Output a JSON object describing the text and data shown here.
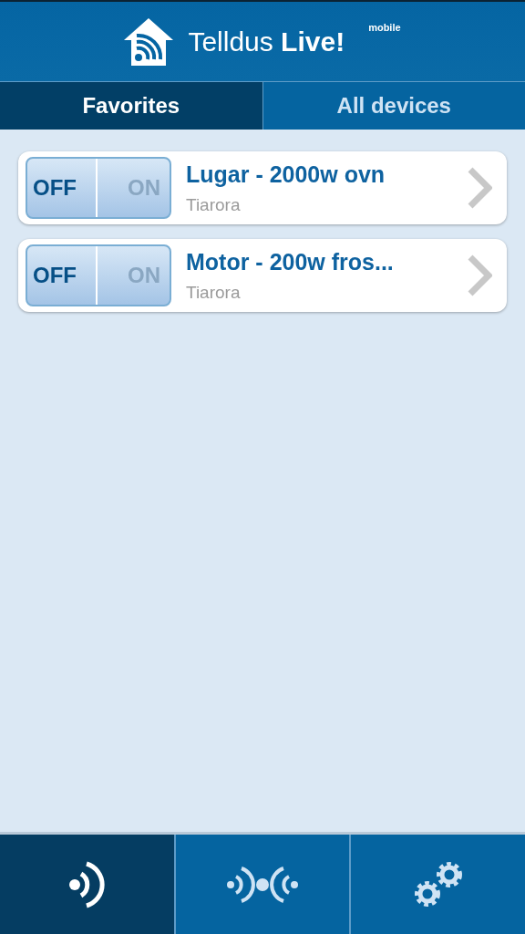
{
  "header": {
    "title": "Telldus **Live!**",
    "badge": "mobile"
  },
  "tabs": [
    {
      "label": "Favorites",
      "selected": true
    },
    {
      "label": "All devices",
      "selected": false
    }
  ],
  "devices": [
    {
      "name": "Lugar - 2000w ovn",
      "location": "Tiarora",
      "off_label": "OFF",
      "on_label": "ON",
      "on": false
    },
    {
      "name": "Motor - 200w fros...",
      "location": "Tiarora",
      "off_label": "OFF",
      "on_label": "ON",
      "on": false
    }
  ],
  "bottom_nav": [
    {
      "kind": "signal",
      "selected": true
    },
    {
      "kind": "link",
      "selected": false
    },
    {
      "kind": "gears",
      "selected": false
    }
  ]
}
